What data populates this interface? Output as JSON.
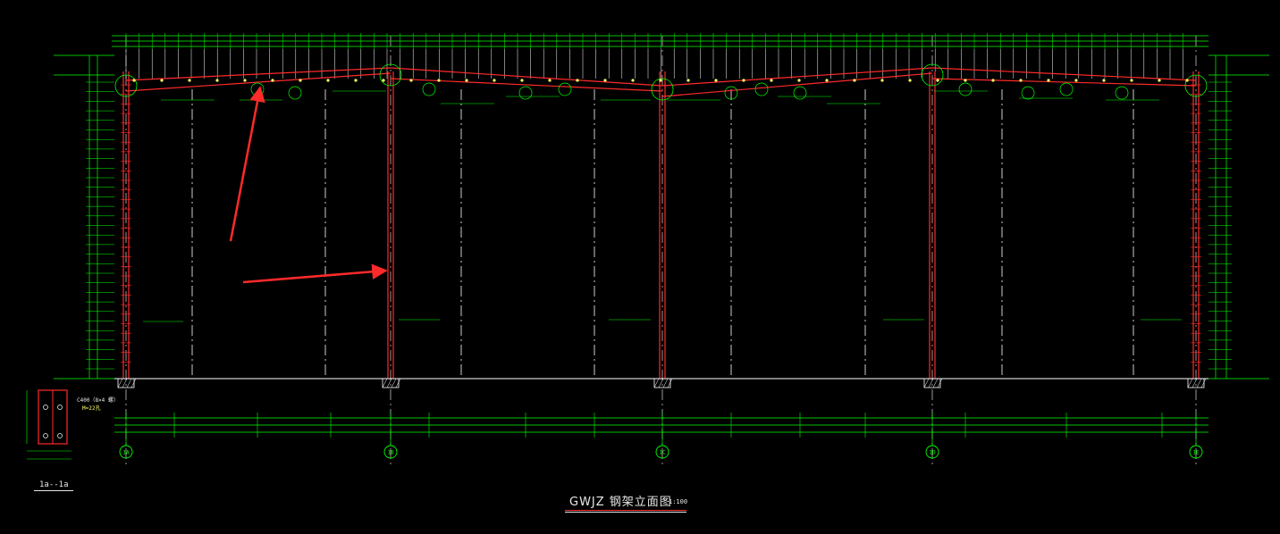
{
  "drawing": {
    "title": "GWJZ 钢架立面图",
    "scale": "1:100",
    "section_label": "1a--1a",
    "detail_note_1": "C400（8×4 螺）",
    "detail_note_2": "M=22孔"
  },
  "colors": {
    "background": "#000000",
    "grid": "#ffffff",
    "dimension": "#00ff00",
    "member": "#ff2a2a",
    "annotation_arrow": "#ff2a2a",
    "label": "#ffff66"
  },
  "annotations": {
    "arrow_count": 2,
    "arrow_targets": [
      "roof beam",
      "interior column"
    ]
  },
  "axis_bubbles": [
    "1A",
    "1B",
    "1C",
    "1D",
    "1E"
  ]
}
